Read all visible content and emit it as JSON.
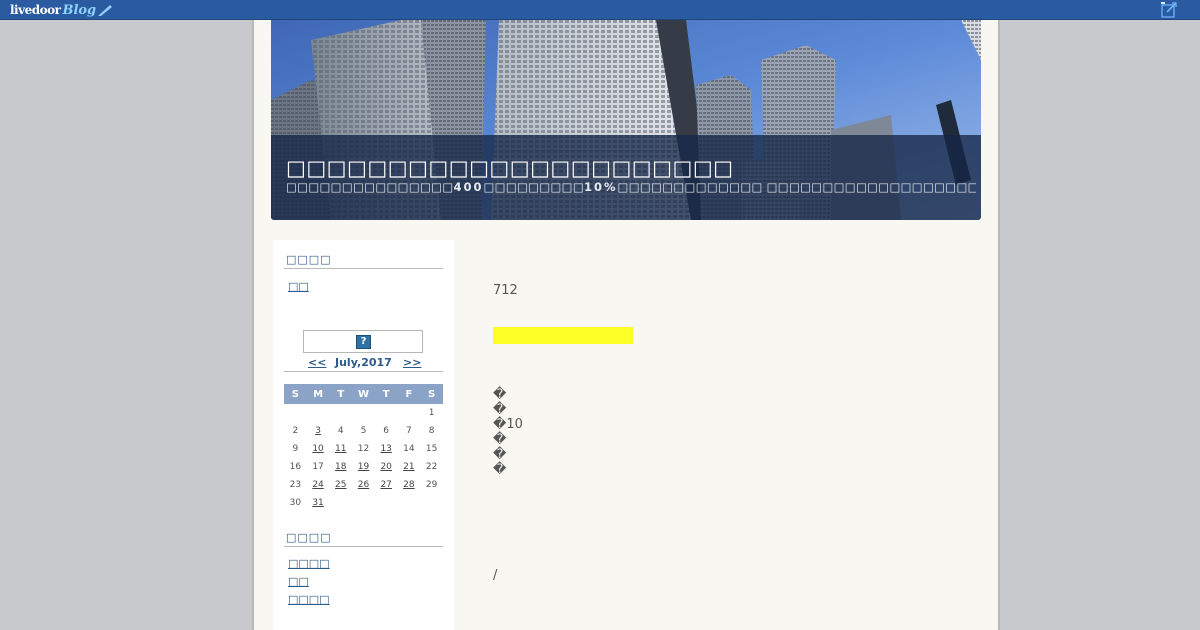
{
  "topbar": {
    "logo_text": "livedoor",
    "logo_suffix": "Blog",
    "edit_icon": "edit-icon"
  },
  "header": {
    "title": "□□□□□□□□□□□□□□□□□□□□□□",
    "description_parts": [
      "□□□□□□□□□□□□□□□",
      "400",
      "□□□□□□□□□",
      "10%",
      "□□□□□□□□□□□□□ □□□□□□□□□□□□□□□□□□□□□□□□□□□"
    ]
  },
  "sidebar": {
    "section1_heading": "□□□□",
    "section1_link": "□□",
    "calendar": {
      "icon": "broken-image-icon",
      "icon_glyph": "?",
      "prev": "<<",
      "month": "July,2017",
      "next": ">>",
      "weekdays": [
        "S",
        "M",
        "T",
        "W",
        "T",
        "F",
        "S"
      ],
      "weeks": [
        [
          "",
          "",
          "",
          "",
          "",
          "",
          "1"
        ],
        [
          "2",
          "3",
          "4",
          "5",
          "6",
          "7",
          "8"
        ],
        [
          "9",
          "10",
          "11",
          "12",
          "13",
          "14",
          "15"
        ],
        [
          "16",
          "17",
          "18",
          "19",
          "20",
          "21",
          "22"
        ],
        [
          "23",
          "24",
          "25",
          "26",
          "27",
          "28",
          "29"
        ],
        [
          "30",
          "31",
          "",
          "",
          "",
          "",
          ""
        ]
      ],
      "linked_days": [
        "3",
        "10",
        "11",
        "13",
        "18",
        "19",
        "20",
        "21",
        "24",
        "25",
        "26",
        "27",
        "28",
        "31"
      ]
    },
    "section2_heading": "□□□□",
    "section2_links": [
      "□□□□",
      "□□",
      "□□□□"
    ]
  },
  "main": {
    "date_text": "712",
    "lines": [
      "�",
      "�",
      "�10",
      "�",
      "�",
      "�"
    ],
    "footer_text": "/",
    "highlight_color": "#ffff28"
  }
}
